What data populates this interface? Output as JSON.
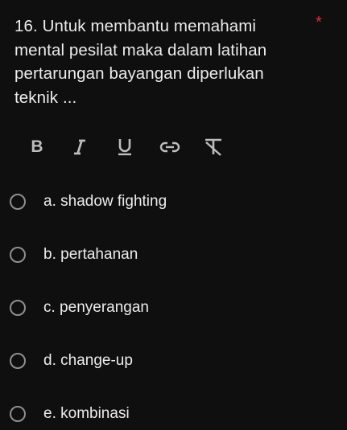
{
  "question": {
    "text": "16. Untuk membantu memahami mental pesilat maka dalam latihan pertarungan bayangan diperlukan teknik ...",
    "required_marker": "*"
  },
  "toolbar": {
    "bold_label": "B",
    "icons": [
      "italic-icon",
      "underline-icon",
      "link-icon",
      "clear-format-icon"
    ]
  },
  "options": [
    {
      "label": "a. shadow fighting"
    },
    {
      "label": "b. pertahanan"
    },
    {
      "label": "c. penyerangan"
    },
    {
      "label": "d. change-up"
    },
    {
      "label": "e. kombinasi"
    }
  ],
  "colors": {
    "background": "#0f0f10",
    "text": "#ececec",
    "required": "#d7303b",
    "radio_border": "#8f8f92",
    "toolbar_icon": "#bdbdbd"
  }
}
